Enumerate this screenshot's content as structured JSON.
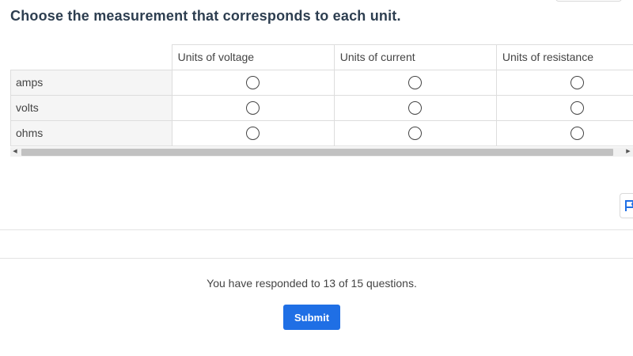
{
  "question": {
    "title": "Choose the measurement that corresponds to each unit."
  },
  "matrix": {
    "columns": [
      "Units of voltage",
      "Units of current",
      "Units of resistance"
    ],
    "rows": [
      "amps",
      "volts",
      "ohms"
    ]
  },
  "scrollbar": {
    "left_arrow": "◀",
    "right_arrow": "▶"
  },
  "progress": {
    "text": "You have responded to 13 of 15 questions."
  },
  "submit": {
    "label": "Submit"
  },
  "colors": {
    "accent": "#1f6fe5",
    "title": "#2d3e50",
    "row_header_bg": "#f5f5f5",
    "border": "#dddddd"
  },
  "icons": [
    "flag-icon",
    "radio-button",
    "scroll-left-arrow-icon",
    "scroll-right-arrow-icon"
  ]
}
